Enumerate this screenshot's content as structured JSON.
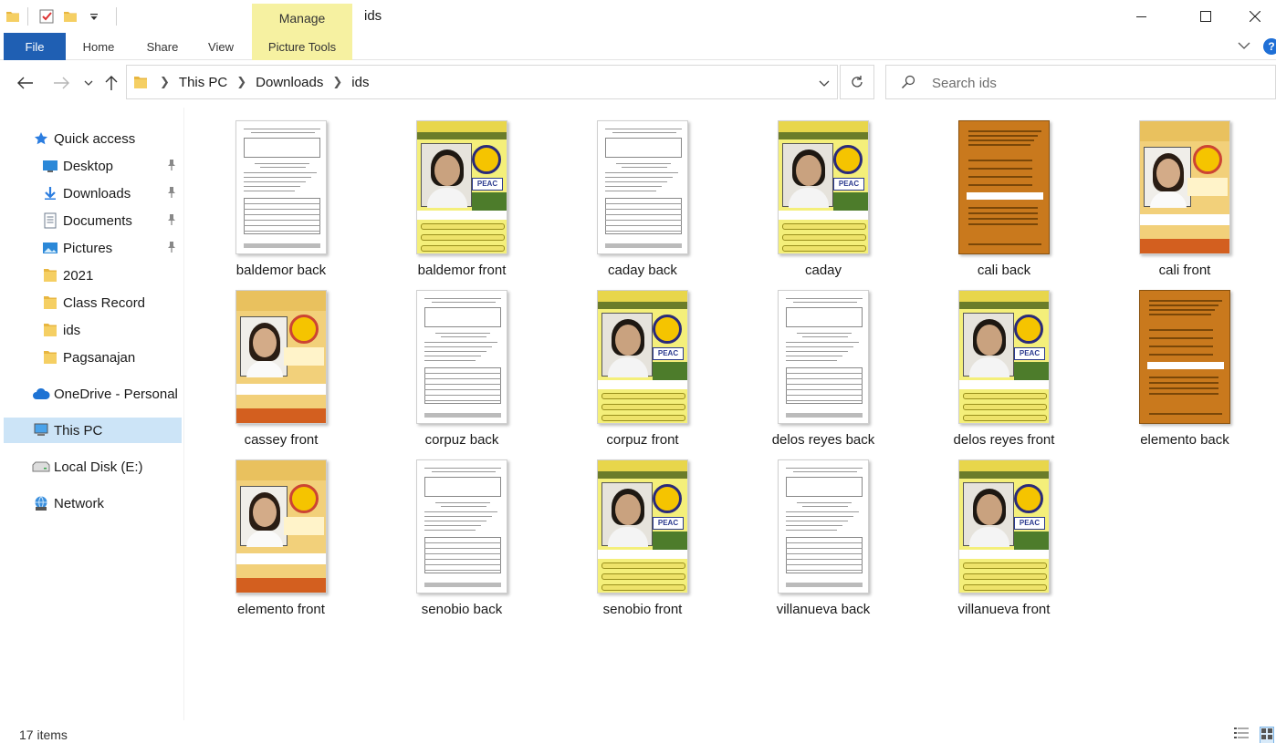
{
  "window": {
    "title": "ids",
    "manage_label": "Manage"
  },
  "ribbon": {
    "tabs": [
      "File",
      "Home",
      "Share",
      "View",
      "Picture Tools"
    ]
  },
  "address": {
    "crumbs": [
      "This PC",
      "Downloads",
      "ids"
    ]
  },
  "search": {
    "placeholder": "Search ids"
  },
  "sidebar": {
    "items": [
      {
        "label": "Quick access",
        "icon": "star-icon"
      },
      {
        "label": "Desktop",
        "icon": "desktop-icon",
        "pinned": true
      },
      {
        "label": "Downloads",
        "icon": "download-icon",
        "pinned": true
      },
      {
        "label": "Documents",
        "icon": "documents-icon",
        "pinned": true
      },
      {
        "label": "Pictures",
        "icon": "pictures-icon",
        "pinned": true
      },
      {
        "label": "2021",
        "icon": "folder-icon"
      },
      {
        "label": "Class Record",
        "icon": "folder-icon"
      },
      {
        "label": "ids",
        "icon": "folder-icon"
      },
      {
        "label": "Pagsanajan",
        "icon": "folder-icon"
      },
      {
        "label": "OneDrive - Personal",
        "icon": "cloud-icon"
      },
      {
        "label": "This PC",
        "icon": "computer-icon",
        "selected": true
      },
      {
        "label": "Local Disk (E:)",
        "icon": "drive-icon"
      },
      {
        "label": "Network",
        "icon": "network-icon"
      }
    ]
  },
  "files": [
    {
      "name": "baldemor back",
      "kind": "back"
    },
    {
      "name": "baldemor front",
      "kind": "shs"
    },
    {
      "name": "caday back",
      "kind": "back"
    },
    {
      "name": "caday",
      "kind": "shs"
    },
    {
      "name": "cali back",
      "kind": "brown"
    },
    {
      "name": "cali front",
      "kind": "jhs"
    },
    {
      "name": "cassey front",
      "kind": "jhs"
    },
    {
      "name": "corpuz back",
      "kind": "back"
    },
    {
      "name": "corpuz front",
      "kind": "shs"
    },
    {
      "name": "delos reyes back",
      "kind": "back"
    },
    {
      "name": "delos reyes front",
      "kind": "shs"
    },
    {
      "name": "elemento back",
      "kind": "brown"
    },
    {
      "name": "elemento front",
      "kind": "jhs"
    },
    {
      "name": "senobio back",
      "kind": "back"
    },
    {
      "name": "senobio front",
      "kind": "shs"
    },
    {
      "name": "villanueva back",
      "kind": "back"
    },
    {
      "name": "villanueva front",
      "kind": "shs"
    }
  ],
  "status": {
    "item_count": "17 items"
  },
  "colors": {
    "accent": "#1f5fb3",
    "manage_tab": "#f6f1a1",
    "selected": "#cce4f7"
  }
}
